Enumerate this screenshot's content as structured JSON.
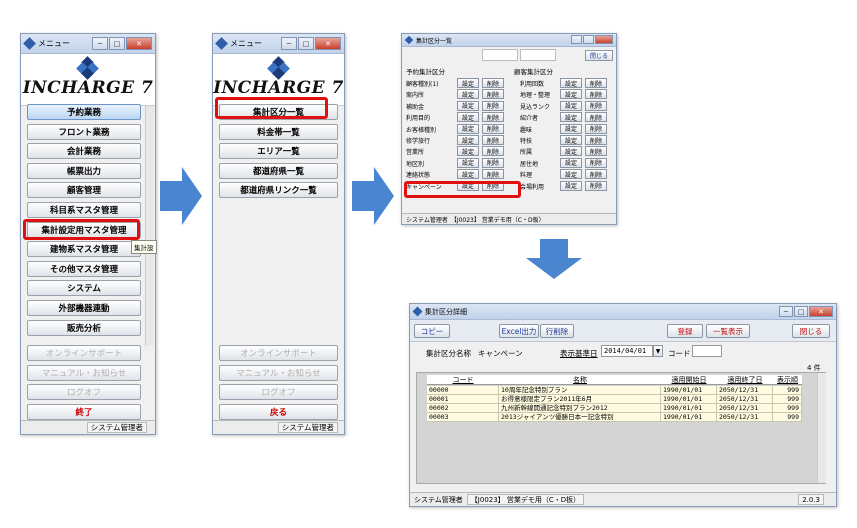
{
  "win1": {
    "title": "メニュー",
    "logo": "INCHARGE 7",
    "items": [
      "予約業務",
      "フロント業務",
      "会計業務",
      "帳票出力",
      "顧客管理",
      "科目系マスタ管理",
      "集計設定用マスタ管理",
      "建物系マスタ管理",
      "その他マスタ管理",
      "システム",
      "外部機器連動",
      "販売分析"
    ],
    "tooltip": "集計設",
    "lower": [
      "オンラインサポート",
      "マニュアル・お知らせ",
      "ログオフ"
    ],
    "exit": "終了",
    "status": "システム管理者"
  },
  "win2": {
    "title": "メニュー",
    "logo": "INCHARGE 7",
    "items": [
      "集計区分一覧",
      "料金帯一覧",
      "エリア一覧",
      "都道府県一覧",
      "都道府県リンク一覧"
    ],
    "lower": [
      "オンラインサポート",
      "マニュアル・お知らせ",
      "ログオフ"
    ],
    "back": "戻る",
    "status": "システム管理者"
  },
  "win3": {
    "title": "集計区分一覧",
    "close_label": "閉じる",
    "group_left": "予約集計区分",
    "group_right": "顧客集計区分",
    "set_label": "設定",
    "del_label": "削除",
    "left_rows": [
      "顧客種別(1)",
      "案内所",
      "補助金",
      "利用目的",
      "お客様種別",
      "修学旅行",
      "営業所",
      "地区別",
      "連絡状態",
      "キャンペーン"
    ],
    "right_rows": [
      "利用回数",
      "地理・整理",
      "見込ランク",
      "紹介者",
      "趣味",
      "特技",
      "所属",
      "居住地",
      "料理",
      "会場利用"
    ],
    "status_user": "システム管理者",
    "status_db": "【J0023】 営業デモ用（C・D板）"
  },
  "win4": {
    "title": "集計区分詳細",
    "toolbar": {
      "copy": "コピー",
      "excel": "Excel出力",
      "rowdel": "行削除",
      "register": "登録",
      "list": "一覧表示",
      "close": "閉じる"
    },
    "form": {
      "name_label": "集計区分名称",
      "name_value": "キャンペーン",
      "date_label": "表示基準日",
      "date_value": "2014/04/01",
      "code_label": "コード",
      "count": "4 件"
    },
    "columns": [
      "コード",
      "名称",
      "適用開始日",
      "適用終了日",
      "表示順"
    ],
    "rows": [
      {
        "code": "00000",
        "name": "10周年記念特別プラン",
        "start": "1990/01/01",
        "end": "2050/12/31",
        "order": "999"
      },
      {
        "code": "00001",
        "name": "お得意様限定プラン2011年6月",
        "start": "1990/01/01",
        "end": "2050/12/31",
        "order": "999"
      },
      {
        "code": "00002",
        "name": "九州新幹線開通記念特別プラン2012",
        "start": "1990/01/01",
        "end": "2050/12/31",
        "order": "999"
      },
      {
        "code": "00003",
        "name": "2013ジャイアンツ優勝日本一記念特別",
        "start": "1990/01/01",
        "end": "2050/12/31",
        "order": "999"
      }
    ],
    "status_user": "システム管理者",
    "status_db": "【J0023】 営業デモ用（C・D板）",
    "version": "2.0.3"
  },
  "colors": {
    "highlight": "#e01010",
    "arrow": "#4a86d0",
    "row_bg": "#fffbe0"
  }
}
